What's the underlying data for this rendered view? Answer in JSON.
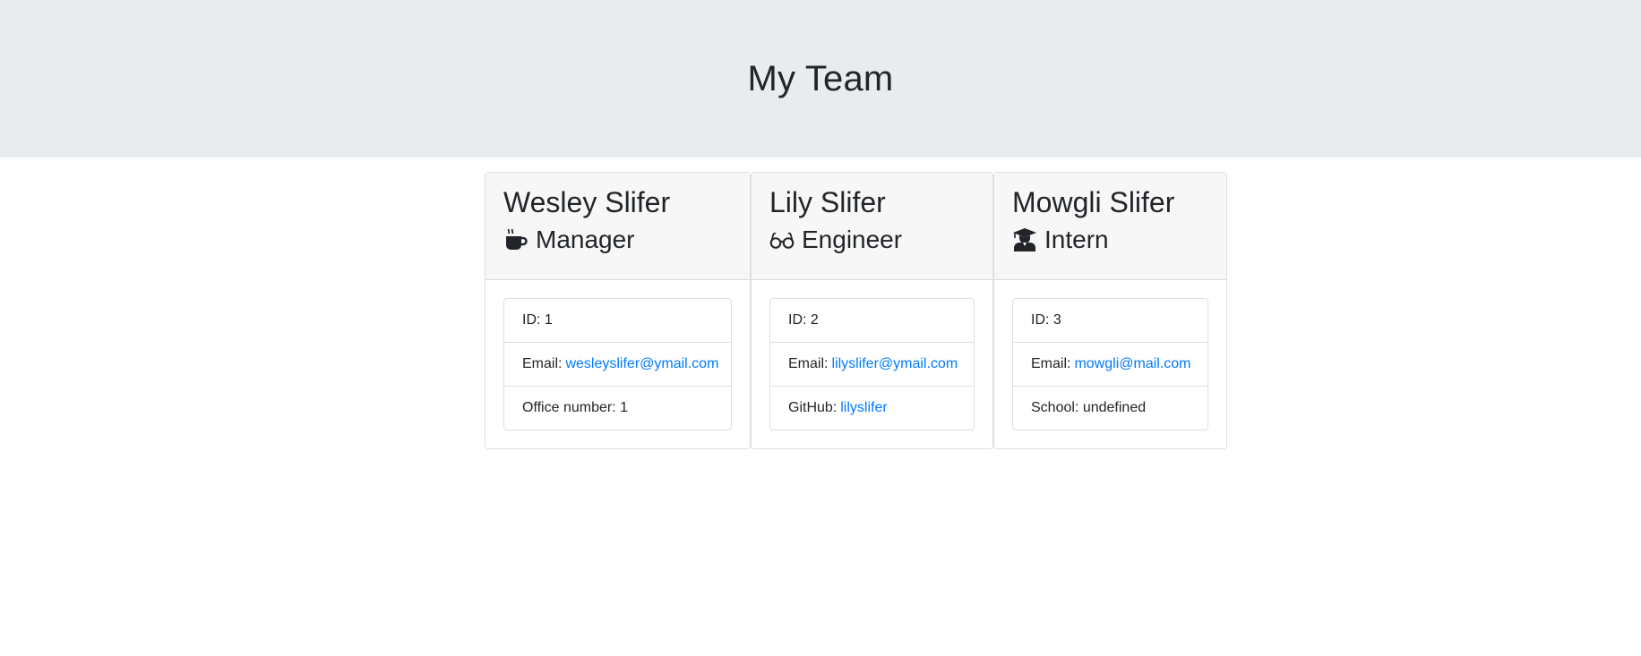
{
  "header": {
    "title": "My Team"
  },
  "employees": [
    {
      "name": "Wesley Slifer",
      "role": "Manager",
      "role_icon": "coffee-mug-icon",
      "id_label": "ID:",
      "id_value": "1",
      "email_label": "Email:",
      "email": "wesleyslifer@ymail.com",
      "extra_label": "Office number:",
      "extra_value": "1"
    },
    {
      "name": "Lily Slifer",
      "role": "Engineer",
      "role_icon": "glasses-icon",
      "id_label": "ID:",
      "id_value": "2",
      "email_label": "Email:",
      "email": "lilyslifer@ymail.com",
      "extra_label": "GitHub:",
      "extra_value": "lilyslifer"
    },
    {
      "name": "Mowgli Slifer",
      "role": "Intern",
      "role_icon": "graduate-icon",
      "id_label": "ID:",
      "id_value": "3",
      "email_label": "Email:",
      "email": "mowgli@mail.com",
      "extra_label": "School:",
      "extra_value": "undefined"
    }
  ],
  "colors": {
    "jumbotron_bg": "#e9ecef",
    "card_header_bg": "#f7f7f7",
    "link": "#007bff",
    "text": "#212529"
  }
}
